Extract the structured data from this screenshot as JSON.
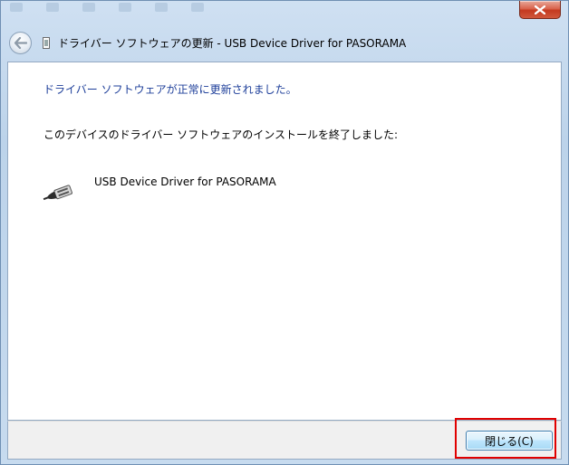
{
  "window": {
    "title": "ドライバー ソフトウェアの更新 - USB Device Driver for PASORAMA",
    "close_icon": "close-icon",
    "back_icon": "back-arrow-icon"
  },
  "content": {
    "heading": "ドライバー ソフトウェアが正常に更新されました。",
    "message": "このデバイスのドライバー ソフトウェアのインストールを終了しました:",
    "device": {
      "name": "USB Device Driver for PASORAMA",
      "icon": "usb-plug-icon"
    }
  },
  "footer": {
    "close_button_label": "閉じる(C)"
  },
  "colors": {
    "heading": "#1e3f9a",
    "highlight": "#e10000",
    "close_button_bg": "#bee6fd"
  }
}
